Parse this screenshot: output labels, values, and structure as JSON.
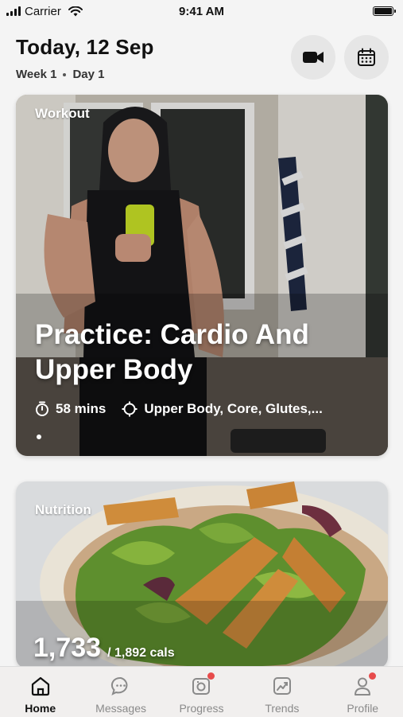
{
  "status_bar": {
    "carrier": "Carrier",
    "time": "9:41 AM"
  },
  "header": {
    "title": "Today, 12 Sep",
    "week": "Week 1",
    "day": "Day 1",
    "video_icon": "video-camera-icon",
    "calendar_icon": "calendar-icon"
  },
  "workout_card": {
    "tag": "Workout",
    "title": "Practice: Cardio And Upper Body",
    "duration": "58 mins",
    "focus": "Upper Body, Core, Glutes,...",
    "duration_icon": "timer-icon",
    "focus_icon": "crosshair-icon"
  },
  "nutrition_card": {
    "tag": "Nutrition",
    "calories": "1,733",
    "calories_total": "/ 1,892 cals"
  },
  "tab_bar": {
    "tabs": [
      {
        "label": "Home",
        "icon": "home-icon",
        "active": true
      },
      {
        "label": "Messages",
        "icon": "chat-bubble-icon",
        "active": false
      },
      {
        "label": "Progress",
        "icon": "camera-icon",
        "active": false,
        "badge": true
      },
      {
        "label": "Trends",
        "icon": "trend-chart-icon",
        "active": false
      },
      {
        "label": "Profile",
        "icon": "person-icon",
        "active": false,
        "badge": true
      }
    ]
  },
  "colors": {
    "badge": "#e74b4b",
    "accent": "#111111",
    "tab_inactive": "#8a8a8a"
  }
}
